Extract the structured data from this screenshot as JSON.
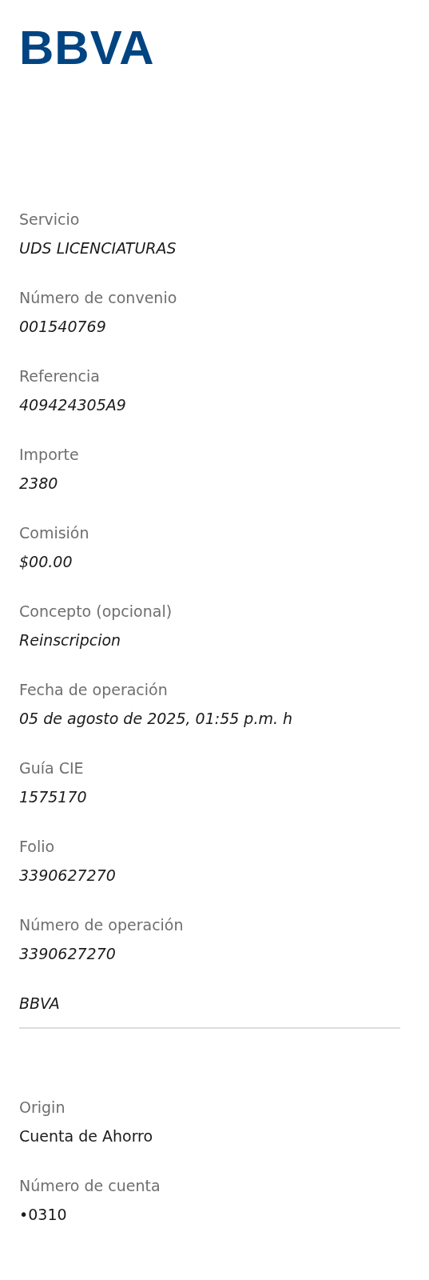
{
  "logo": "BBVA",
  "details": [
    {
      "label": "Servicio",
      "value": "UDS LICENCIATURAS"
    },
    {
      "label": "Número de convenio",
      "value": "001540769"
    },
    {
      "label": "Referencia",
      "value": "409424305A9"
    },
    {
      "label": "Importe",
      "value": "2380"
    },
    {
      "label": "Comisión",
      "value": "$00.00"
    },
    {
      "label": "Concepto (opcional)",
      "value": "Reinscripcion"
    },
    {
      "label": "Fecha de operación",
      "value": "05 de agosto de 2025, 01:55 p.m. h"
    },
    {
      "label": "Guía CIE",
      "value": "1575170"
    },
    {
      "label": "Folio",
      "value": "3390627270"
    },
    {
      "label": "Número de operación",
      "value": "3390627270"
    }
  ],
  "bank_note": "BBVA",
  "account": [
    {
      "label": "Origin",
      "value": "Cuenta de Ahorro"
    },
    {
      "label": "Número de cuenta",
      "value": "•0310"
    }
  ]
}
